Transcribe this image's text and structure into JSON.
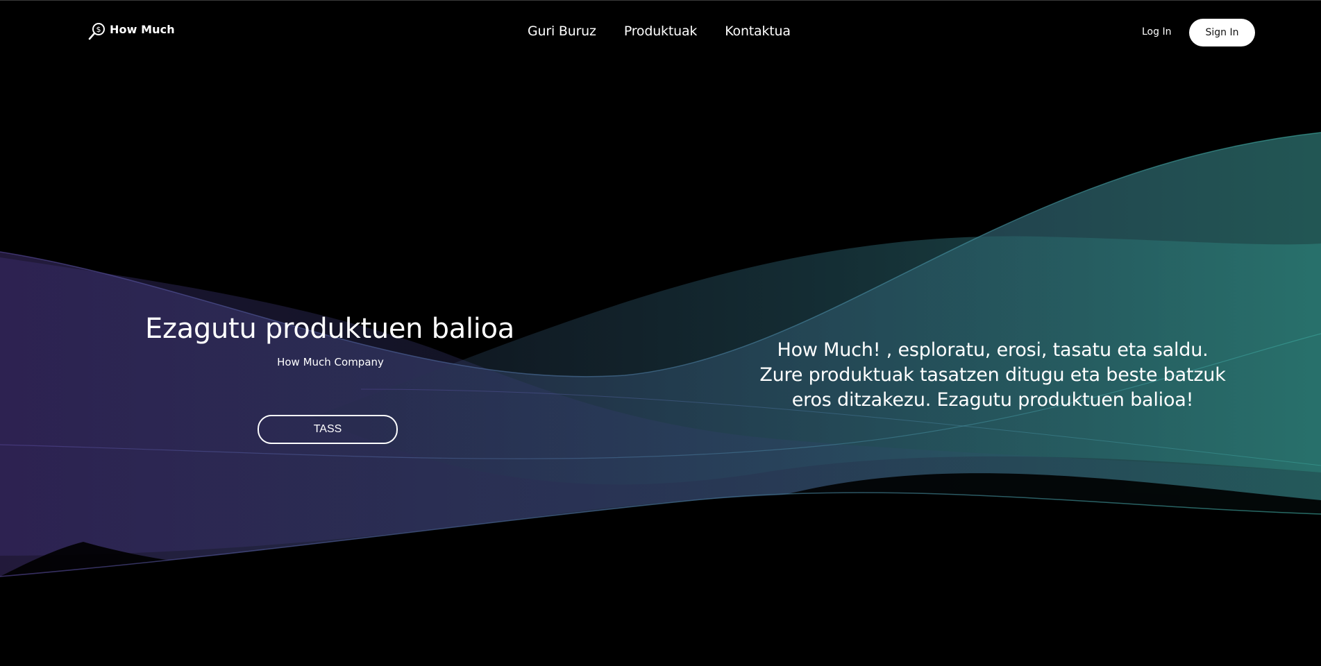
{
  "brand": {
    "name": "How Much",
    "icon": "magnifier-dollar-icon"
  },
  "nav": {
    "items": [
      {
        "label": "Guri Buruz"
      },
      {
        "label": "Produktuak"
      },
      {
        "label": "Kontaktua"
      }
    ]
  },
  "auth": {
    "login_label": "Log In",
    "signin_label": "Sign In"
  },
  "hero": {
    "title": "Ezagutu produktuen balioa",
    "subtitle": "How Much Company",
    "button_label": "TASS",
    "description_lines": [
      "How Much! , esploratu, erosi, tasatu eta saldu.",
      "Zure produktuak tasatzen ditugu eta beste batzuk",
      "eros ditzakezu. Ezagutu produktuen balioa!"
    ]
  },
  "colors": {
    "background": "#000000",
    "wave_purple": "#3a2e6b",
    "wave_teal": "#2f8a83",
    "button_bg": "#ffffff",
    "text": "#ffffff"
  }
}
